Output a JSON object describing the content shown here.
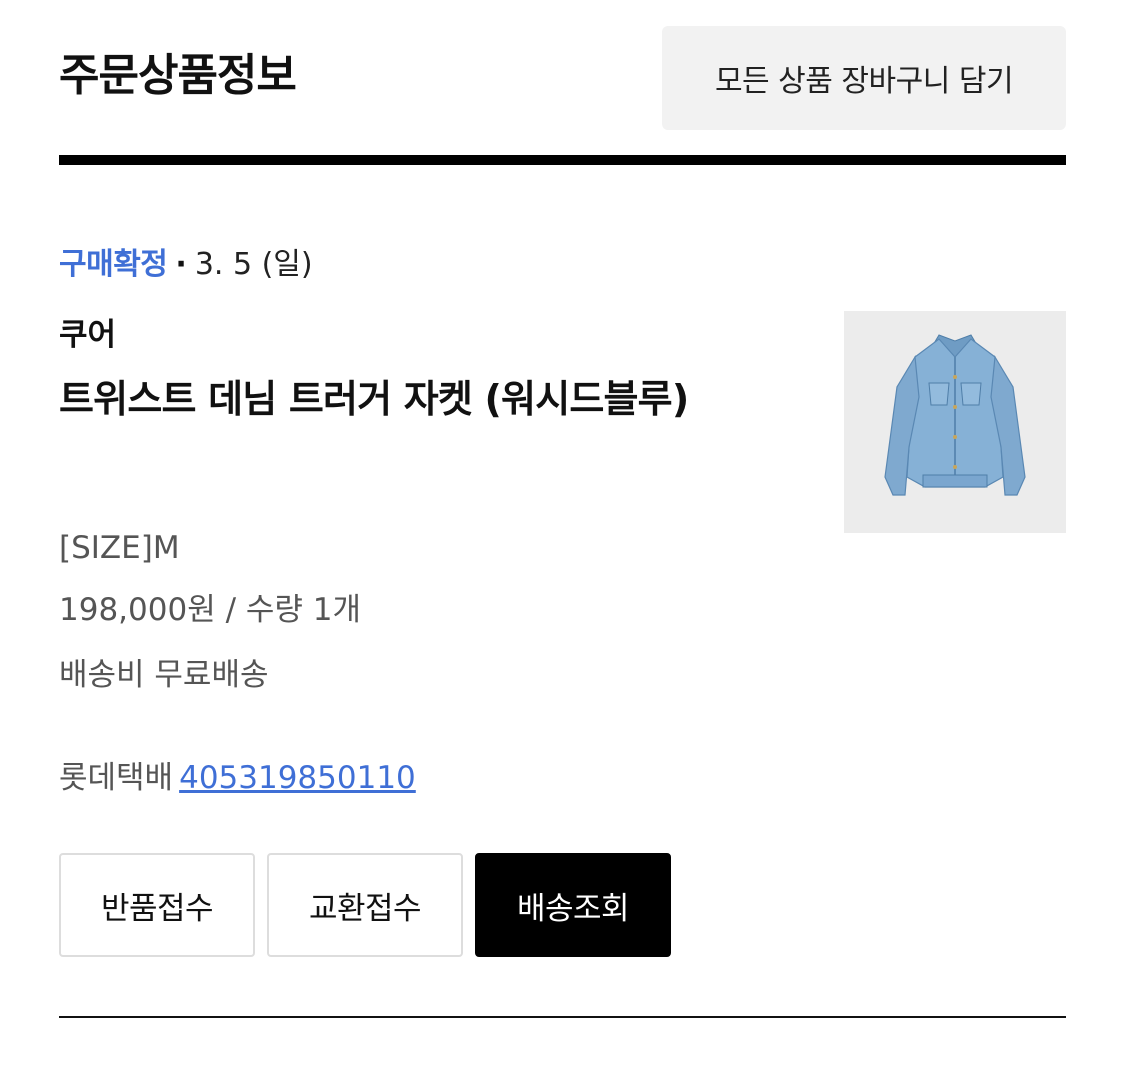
{
  "header": {
    "title": "주문상품정보",
    "add_all_label": "모든 상품 장바구니 담기"
  },
  "order_item": {
    "status": "구매확정",
    "separator": "·",
    "date": "3. 5 (일)",
    "brand": "쿠어",
    "name": "트위스트 데님 트러거 자켓 (워시드블루)",
    "option": "[SIZE]M",
    "price_qty": "198,000원 / 수량 1개",
    "shipping": "배송비 무료배송",
    "courier": "롯데택배",
    "tracking_number": "405319850110",
    "thumbnail_icon": "denim-jacket-image"
  },
  "actions": {
    "return_label": "반품접수",
    "exchange_label": "교환접수",
    "track_label": "배송조회"
  },
  "colors": {
    "accent": "#3f6fd6",
    "primary_button": "#000000",
    "secondary_bg": "#f2f2f2"
  }
}
